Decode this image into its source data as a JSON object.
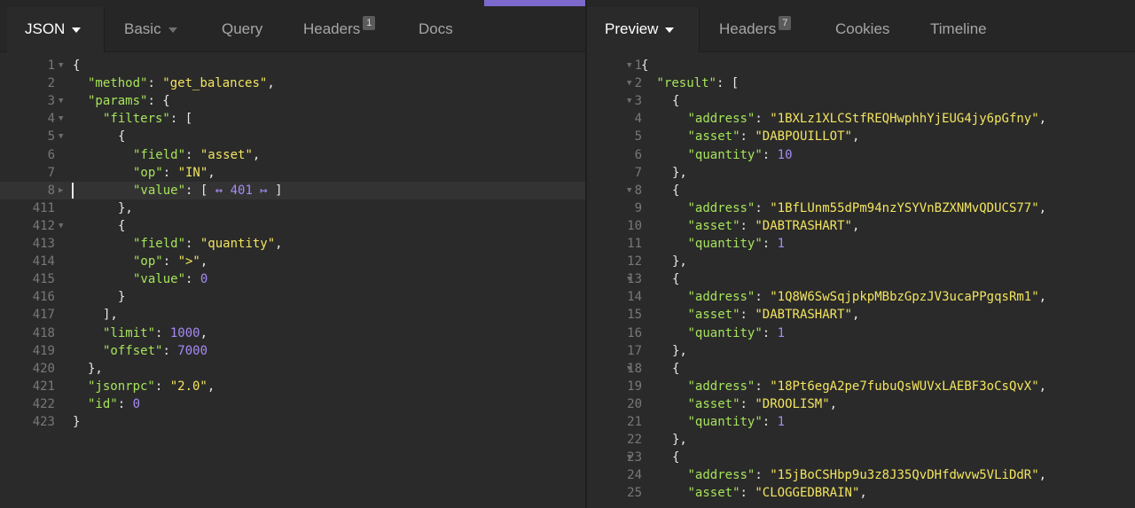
{
  "left_tabs": [
    {
      "label": "JSON",
      "active": true,
      "dropdown": true
    },
    {
      "label": "Basic",
      "dropdown": true
    },
    {
      "label": "Query"
    },
    {
      "label": "Headers",
      "badge": "1"
    },
    {
      "label": "Docs"
    }
  ],
  "right_tabs": [
    {
      "label": "Preview",
      "active": true,
      "dropdown": true
    },
    {
      "label": "Headers",
      "badge": "7"
    },
    {
      "label": "Cookies"
    },
    {
      "label": "Timeline"
    }
  ],
  "request_lines": [
    {
      "n": "1",
      "fold": "open",
      "indent": 0,
      "t": [
        [
          "{",
          "p"
        ]
      ]
    },
    {
      "n": "2",
      "indent": 1,
      "t": [
        [
          "\"method\"",
          "k"
        ],
        [
          ": ",
          "p"
        ],
        [
          "\"get_balances\"",
          "s"
        ],
        [
          ",",
          "p"
        ]
      ]
    },
    {
      "n": "3",
      "fold": "open",
      "indent": 1,
      "t": [
        [
          "\"params\"",
          "k"
        ],
        [
          ": {",
          "p"
        ]
      ]
    },
    {
      "n": "4",
      "fold": "open",
      "indent": 2,
      "t": [
        [
          "\"filters\"",
          "k"
        ],
        [
          ": [",
          "p"
        ]
      ]
    },
    {
      "n": "5",
      "fold": "open",
      "indent": 3,
      "t": [
        [
          "{",
          "p"
        ]
      ]
    },
    {
      "n": "6",
      "indent": 4,
      "t": [
        [
          "\"field\"",
          "k"
        ],
        [
          ": ",
          "p"
        ],
        [
          "\"asset\"",
          "s"
        ],
        [
          ",",
          "p"
        ]
      ]
    },
    {
      "n": "7",
      "indent": 4,
      "t": [
        [
          "\"op\"",
          "k"
        ],
        [
          ": ",
          "p"
        ],
        [
          "\"IN\"",
          "s"
        ],
        [
          ",",
          "p"
        ]
      ]
    },
    {
      "n": "8",
      "fold": "closed",
      "indent": 4,
      "highlight": true,
      "t": [
        [
          "\"value\"",
          "k"
        ],
        [
          ": [ ",
          "p"
        ],
        [
          "↔ 401 ↦",
          "c"
        ],
        [
          " ]",
          "p"
        ]
      ]
    },
    {
      "n": "411",
      "indent": 3,
      "t": [
        [
          "},",
          "p"
        ]
      ]
    },
    {
      "n": "412",
      "fold": "open",
      "indent": 3,
      "t": [
        [
          "{",
          "p"
        ]
      ]
    },
    {
      "n": "413",
      "indent": 4,
      "t": [
        [
          "\"field\"",
          "k"
        ],
        [
          ": ",
          "p"
        ],
        [
          "\"quantity\"",
          "s"
        ],
        [
          ",",
          "p"
        ]
      ]
    },
    {
      "n": "414",
      "indent": 4,
      "t": [
        [
          "\"op\"",
          "k"
        ],
        [
          ": ",
          "p"
        ],
        [
          "\">\"",
          "s"
        ],
        [
          ",",
          "p"
        ]
      ]
    },
    {
      "n": "415",
      "indent": 4,
      "t": [
        [
          "\"value\"",
          "k"
        ],
        [
          ": ",
          "p"
        ],
        [
          "0",
          "n"
        ]
      ]
    },
    {
      "n": "416",
      "indent": 3,
      "t": [
        [
          "}",
          "p"
        ]
      ]
    },
    {
      "n": "417",
      "indent": 2,
      "t": [
        [
          "],",
          "p"
        ]
      ]
    },
    {
      "n": "418",
      "indent": 2,
      "t": [
        [
          "\"limit\"",
          "k"
        ],
        [
          ": ",
          "p"
        ],
        [
          "1000",
          "n"
        ],
        [
          ",",
          "p"
        ]
      ]
    },
    {
      "n": "419",
      "indent": 2,
      "t": [
        [
          "\"offset\"",
          "k"
        ],
        [
          ": ",
          "p"
        ],
        [
          "7000",
          "n"
        ]
      ]
    },
    {
      "n": "420",
      "indent": 1,
      "t": [
        [
          "},",
          "p"
        ]
      ]
    },
    {
      "n": "421",
      "indent": 1,
      "t": [
        [
          "\"jsonrpc\"",
          "k"
        ],
        [
          ": ",
          "p"
        ],
        [
          "\"2.0\"",
          "s"
        ],
        [
          ",",
          "p"
        ]
      ]
    },
    {
      "n": "422",
      "indent": 1,
      "t": [
        [
          "\"id\"",
          "k"
        ],
        [
          ": ",
          "p"
        ],
        [
          "0",
          "n"
        ]
      ]
    },
    {
      "n": "423",
      "indent": 0,
      "t": [
        [
          "}",
          "p"
        ]
      ]
    }
  ],
  "response_lines": [
    {
      "n": "1",
      "fold": "open",
      "indent": 0,
      "t": [
        [
          "{",
          "p"
        ]
      ]
    },
    {
      "n": "2",
      "fold": "open",
      "indent": 1,
      "t": [
        [
          "\"result\"",
          "k"
        ],
        [
          ": [",
          "p"
        ]
      ]
    },
    {
      "n": "3",
      "fold": "open",
      "indent": 2,
      "t": [
        [
          "{",
          "p"
        ]
      ]
    },
    {
      "n": "4",
      "indent": 3,
      "t": [
        [
          "\"address\"",
          "k"
        ],
        [
          ": ",
          "p"
        ],
        [
          "\"1BXLz1XLCStfREQHwphhYjEUG4jy6pGfny\"",
          "s"
        ],
        [
          ",",
          "p"
        ]
      ]
    },
    {
      "n": "5",
      "indent": 3,
      "t": [
        [
          "\"asset\"",
          "k"
        ],
        [
          ": ",
          "p"
        ],
        [
          "\"DABPOUILLOT\"",
          "s"
        ],
        [
          ",",
          "p"
        ]
      ]
    },
    {
      "n": "6",
      "indent": 3,
      "t": [
        [
          "\"quantity\"",
          "k"
        ],
        [
          ": ",
          "p"
        ],
        [
          "10",
          "n"
        ]
      ]
    },
    {
      "n": "7",
      "indent": 2,
      "t": [
        [
          "},",
          "p"
        ]
      ]
    },
    {
      "n": "8",
      "fold": "open",
      "indent": 2,
      "t": [
        [
          "{",
          "p"
        ]
      ]
    },
    {
      "n": "9",
      "indent": 3,
      "t": [
        [
          "\"address\"",
          "k"
        ],
        [
          ": ",
          "p"
        ],
        [
          "\"1BfLUnm55dPm94nzYSYVnBZXNMvQDUCS77\"",
          "s"
        ],
        [
          ",",
          "p"
        ]
      ]
    },
    {
      "n": "10",
      "indent": 3,
      "t": [
        [
          "\"asset\"",
          "k"
        ],
        [
          ": ",
          "p"
        ],
        [
          "\"DABTRASHART\"",
          "s"
        ],
        [
          ",",
          "p"
        ]
      ]
    },
    {
      "n": "11",
      "indent": 3,
      "t": [
        [
          "\"quantity\"",
          "k"
        ],
        [
          ": ",
          "p"
        ],
        [
          "1",
          "n"
        ]
      ]
    },
    {
      "n": "12",
      "indent": 2,
      "t": [
        [
          "},",
          "p"
        ]
      ]
    },
    {
      "n": "13",
      "fold": "open",
      "indent": 2,
      "t": [
        [
          "{",
          "p"
        ]
      ]
    },
    {
      "n": "14",
      "indent": 3,
      "t": [
        [
          "\"address\"",
          "k"
        ],
        [
          ": ",
          "p"
        ],
        [
          "\"1Q8W6SwSqjpkpMBbzGpzJV3ucaPPgqsRm1\"",
          "s"
        ],
        [
          ",",
          "p"
        ]
      ]
    },
    {
      "n": "15",
      "indent": 3,
      "t": [
        [
          "\"asset\"",
          "k"
        ],
        [
          ": ",
          "p"
        ],
        [
          "\"DABTRASHART\"",
          "s"
        ],
        [
          ",",
          "p"
        ]
      ]
    },
    {
      "n": "16",
      "indent": 3,
      "t": [
        [
          "\"quantity\"",
          "k"
        ],
        [
          ": ",
          "p"
        ],
        [
          "1",
          "n"
        ]
      ]
    },
    {
      "n": "17",
      "indent": 2,
      "t": [
        [
          "},",
          "p"
        ]
      ]
    },
    {
      "n": "18",
      "fold": "open",
      "indent": 2,
      "t": [
        [
          "{",
          "p"
        ]
      ]
    },
    {
      "n": "19",
      "indent": 3,
      "t": [
        [
          "\"address\"",
          "k"
        ],
        [
          ": ",
          "p"
        ],
        [
          "\"18Pt6egA2pe7fubuQsWUVxLAEBF3oCsQvX\"",
          "s"
        ],
        [
          ",",
          "p"
        ]
      ]
    },
    {
      "n": "20",
      "indent": 3,
      "t": [
        [
          "\"asset\"",
          "k"
        ],
        [
          ": ",
          "p"
        ],
        [
          "\"DROOLISM\"",
          "s"
        ],
        [
          ",",
          "p"
        ]
      ]
    },
    {
      "n": "21",
      "indent": 3,
      "t": [
        [
          "\"quantity\"",
          "k"
        ],
        [
          ": ",
          "p"
        ],
        [
          "1",
          "n"
        ]
      ]
    },
    {
      "n": "22",
      "indent": 2,
      "t": [
        [
          "},",
          "p"
        ]
      ]
    },
    {
      "n": "23",
      "fold": "open",
      "indent": 2,
      "t": [
        [
          "{",
          "p"
        ]
      ]
    },
    {
      "n": "24",
      "indent": 3,
      "t": [
        [
          "\"address\"",
          "k"
        ],
        [
          ": ",
          "p"
        ],
        [
          "\"15jBoCSHbp9u3z8J35QvDHfdwvw5VLiDdR\"",
          "s"
        ],
        [
          ",",
          "p"
        ]
      ]
    },
    {
      "n": "25",
      "indent": 3,
      "t": [
        [
          "\"asset\"",
          "k"
        ],
        [
          ": ",
          "p"
        ],
        [
          "\"CLOGGEDBRAIN\"",
          "s"
        ],
        [
          ",",
          "p"
        ]
      ]
    }
  ],
  "colors": {
    "accent": "#7d69cb",
    "key": "#a6e35b",
    "string": "#f2e45f",
    "number": "#a58bf5"
  },
  "icons": {
    "fold_open": "chevron-down-icon",
    "fold_closed": "chevron-right-icon",
    "dropdown": "caret-down-icon"
  }
}
